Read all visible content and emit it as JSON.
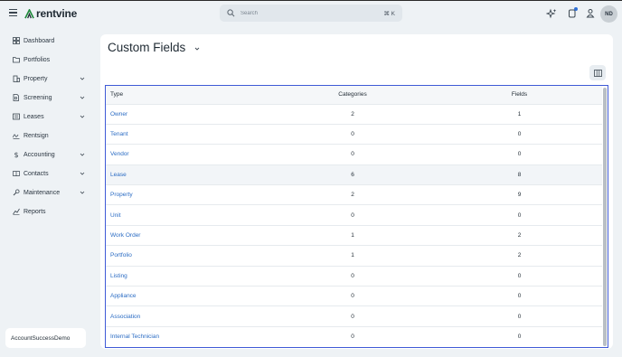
{
  "brand": {
    "name": "rentvine"
  },
  "search": {
    "placeholder": "Search",
    "shortcut": "⌘ K"
  },
  "user": {
    "initials": "ND"
  },
  "sidebar": {
    "items": [
      {
        "label": "Dashboard",
        "icon": "dashboard-icon",
        "has_chevron": false
      },
      {
        "label": "Portfolios",
        "icon": "folder-icon",
        "has_chevron": false
      },
      {
        "label": "Property",
        "icon": "building-icon",
        "has_chevron": true
      },
      {
        "label": "Screening",
        "icon": "document-search-icon",
        "has_chevron": true
      },
      {
        "label": "Leases",
        "icon": "lease-icon",
        "has_chevron": true
      },
      {
        "label": "Rentsign",
        "icon": "signature-icon",
        "has_chevron": false
      },
      {
        "label": "Accounting",
        "icon": "dollar-icon",
        "has_chevron": true
      },
      {
        "label": "Contacts",
        "icon": "contacts-icon",
        "has_chevron": true
      },
      {
        "label": "Maintenance",
        "icon": "wrench-icon",
        "has_chevron": true
      },
      {
        "label": "Reports",
        "icon": "chart-icon",
        "has_chevron": false
      }
    ],
    "account": "AccountSuccessDemo"
  },
  "main": {
    "title": "Custom Fields",
    "table": {
      "headers": [
        "Type",
        "Categories",
        "Fields"
      ],
      "rows": [
        {
          "type": "Owner",
          "categories": "2",
          "fields": "1"
        },
        {
          "type": "Tenant",
          "categories": "0",
          "fields": "0"
        },
        {
          "type": "Vendor",
          "categories": "0",
          "fields": "0"
        },
        {
          "type": "Lease",
          "categories": "6",
          "fields": "8"
        },
        {
          "type": "Property",
          "categories": "2",
          "fields": "9"
        },
        {
          "type": "Unit",
          "categories": "0",
          "fields": "0"
        },
        {
          "type": "Work Order",
          "categories": "1",
          "fields": "2"
        },
        {
          "type": "Portfolio",
          "categories": "1",
          "fields": "2"
        },
        {
          "type": "Listing",
          "categories": "0",
          "fields": "0"
        },
        {
          "type": "Appliance",
          "categories": "0",
          "fields": "0"
        },
        {
          "type": "Association",
          "categories": "0",
          "fields": "0"
        },
        {
          "type": "Internal Technician",
          "categories": "0",
          "fields": "0"
        }
      ]
    }
  },
  "colors": {
    "accent": "#2b6cc4",
    "brand_green": "#1f8a3c",
    "selection_border": "#3f5ad6",
    "notification": "#2f6fd6"
  }
}
